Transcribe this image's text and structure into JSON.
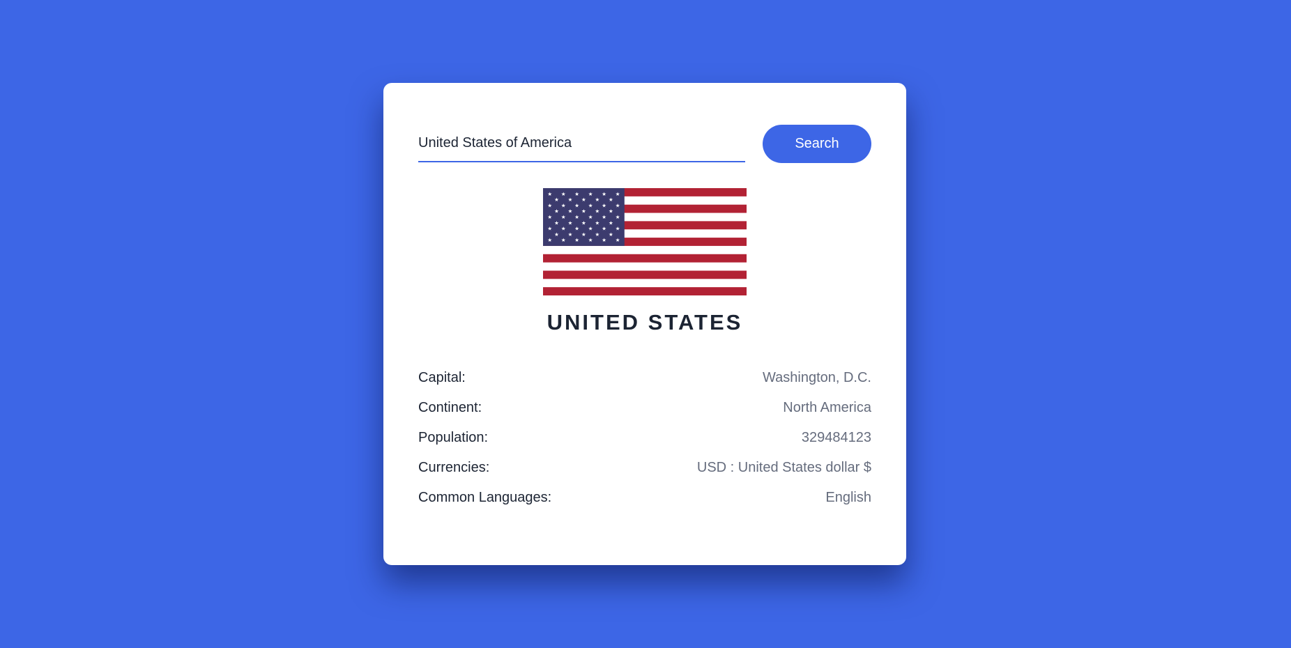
{
  "search": {
    "value": "United States of America",
    "button_label": "Search"
  },
  "country": {
    "name": "UNITED STATES",
    "flag": "flag-of-united-states"
  },
  "info": [
    {
      "label": "Capital:",
      "value": "Washington, D.C."
    },
    {
      "label": "Continent:",
      "value": "North America"
    },
    {
      "label": "Population:",
      "value": "329484123"
    },
    {
      "label": "Currencies:",
      "value": "USD : United States dollar $"
    },
    {
      "label": "Common Languages:",
      "value": "English"
    }
  ],
  "colors": {
    "background": "#3d66e6",
    "accent": "#3d66e6",
    "card": "#ffffff",
    "flag_red": "#b22234",
    "flag_blue": "#3c3b6e",
    "text": "#1c2433",
    "value_text": "#656c7d"
  }
}
